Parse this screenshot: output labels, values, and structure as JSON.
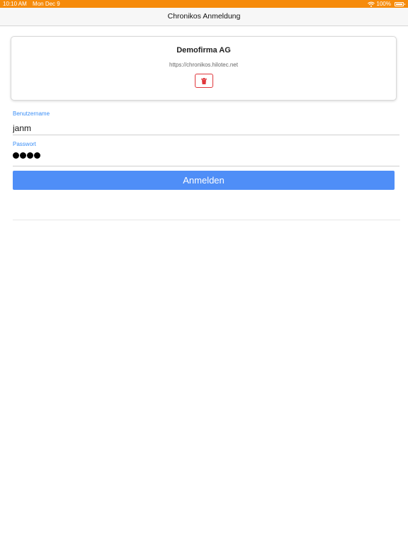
{
  "status_bar": {
    "time": "10:10 AM",
    "date": "Mon Dec 9",
    "battery": "100%",
    "icons": [
      "wifi-icon",
      "battery-icon"
    ]
  },
  "nav": {
    "title": "Chronikos Anmeldung"
  },
  "company": {
    "name": "Demofirma AG",
    "url": "https://chronikos.hilotec.net",
    "delete_icon": "trash-icon"
  },
  "form": {
    "username_label": "Benutzername",
    "username_value": "janm",
    "password_label": "Passwort",
    "password_length": 4,
    "login_label": "Anmelden"
  },
  "colors": {
    "status_bar": "#f68b0b",
    "accent": "#4f8ef7",
    "label": "#3a8ef6",
    "danger": "#e0363b"
  }
}
